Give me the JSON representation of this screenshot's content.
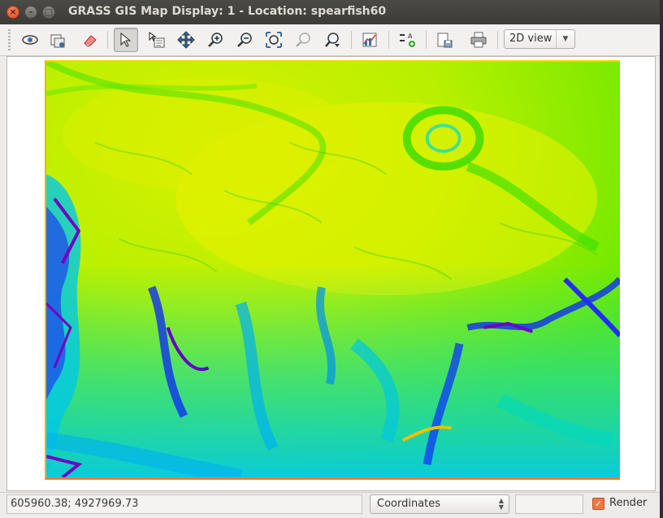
{
  "window": {
    "title": "GRASS GIS Map Display: 1  - Location: spearfish60",
    "close_glyph": "×",
    "minimize_glyph": "–",
    "maximize_glyph": "□"
  },
  "toolbar": {
    "tools": [
      {
        "name": "display-map-icon",
        "active": false
      },
      {
        "name": "render-map-icon",
        "active": false
      },
      {
        "name": "erase-display-icon",
        "active": false
      },
      {
        "name": "pointer-icon",
        "active": true
      },
      {
        "name": "query-raster-icon",
        "active": false
      },
      {
        "name": "pan-icon",
        "active": false
      },
      {
        "name": "zoom-in-icon",
        "active": false
      },
      {
        "name": "zoom-out-icon",
        "active": false
      },
      {
        "name": "zoom-extent-icon",
        "active": false
      },
      {
        "name": "zoom-back-icon",
        "active": false
      },
      {
        "name": "zoom-menu-icon",
        "active": false
      },
      {
        "name": "analyze-icon",
        "active": false
      },
      {
        "name": "overlay-icon",
        "active": false
      },
      {
        "name": "save-image-icon",
        "active": false
      },
      {
        "name": "print-icon",
        "active": false
      }
    ],
    "view_mode": "2D view"
  },
  "map": {
    "description_colors": [
      "#e8f000",
      "#8cf000",
      "#00e800",
      "#00d8d8",
      "#0040ff",
      "#6000c0"
    ]
  },
  "statusbar": {
    "coordinates": "605960.38; 4927969.73",
    "mode": "Coordinates",
    "render_label": "Render",
    "render_checked": true,
    "check_glyph": "✓"
  }
}
